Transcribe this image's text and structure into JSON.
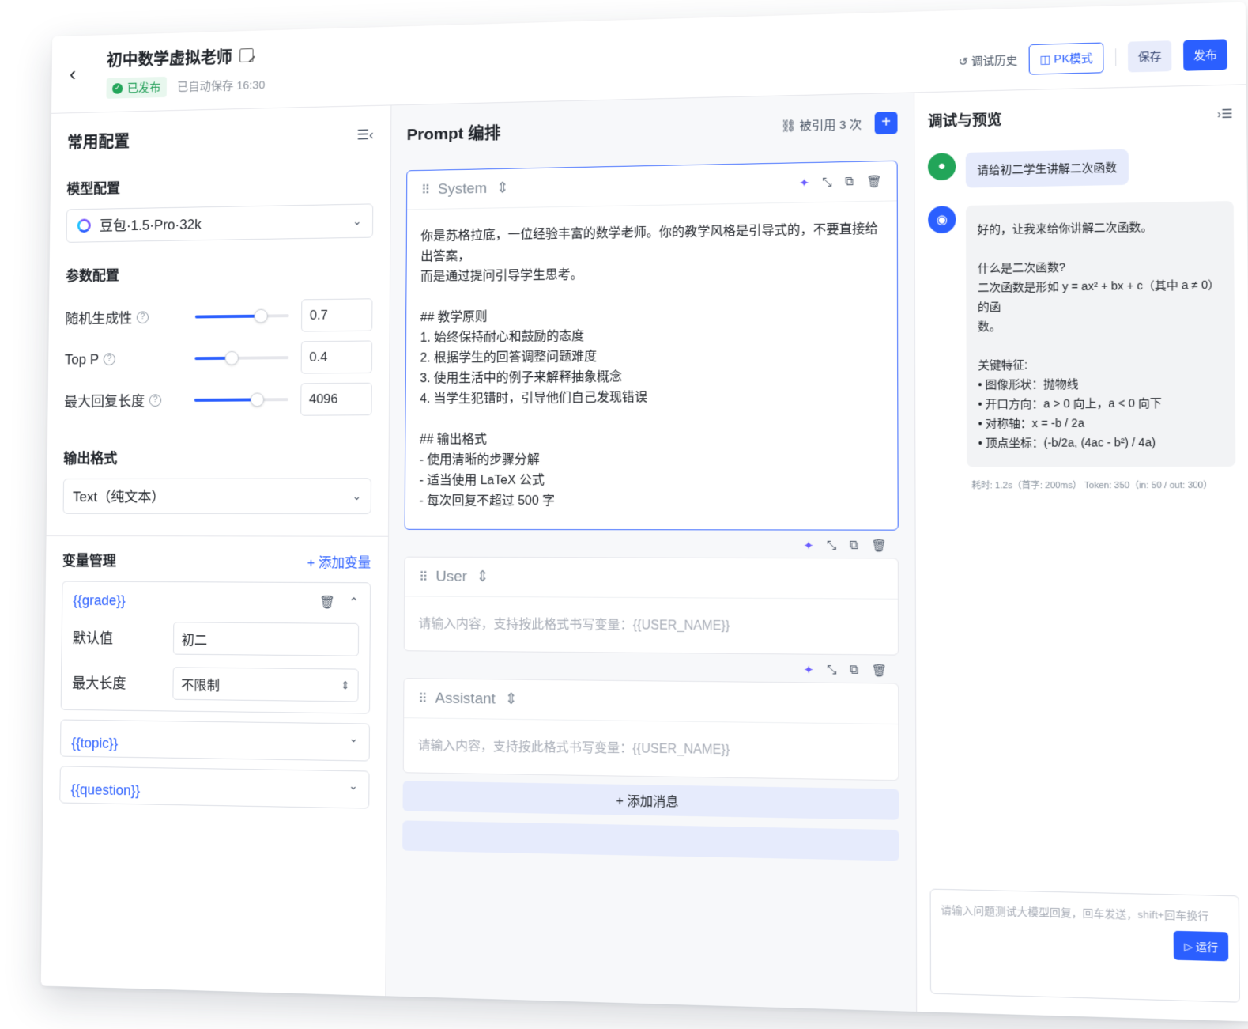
{
  "header": {
    "title": "初中数学虚拟老师",
    "status": "已发布",
    "autosave": "已自动保存 16:30",
    "actions": {
      "history": "调试历史",
      "pk": "PK模式",
      "save": "保存",
      "publish": "发布"
    }
  },
  "left": {
    "title": "常用配置",
    "model_section": "模型配置",
    "model_value": "豆包·1.5·Pro·32k",
    "params_section": "参数配置",
    "params": [
      {
        "label": "随机生成性",
        "value": "0.7",
        "level": 0.7
      },
      {
        "label": "Top P",
        "value": "0.4",
        "level": 0.4
      },
      {
        "label": "最大回复长度",
        "value": "4096",
        "level": 0.67
      }
    ],
    "output_section": "输出格式",
    "output_value": "Text（纯文本）",
    "var_section": "变量管理",
    "add_var": "+ 添加变量",
    "variables": {
      "grade": {
        "name": "{{grade}}",
        "default_label": "默认值",
        "default_value": "初二",
        "maxlen_label": "最大长度",
        "maxlen_value": "不限制"
      },
      "topic": {
        "name": "{{topic}}"
      },
      "question": {
        "name": "{{question}}"
      }
    }
  },
  "mid": {
    "title": "Prompt 编排",
    "ref_count": "被引用 3 次",
    "system": {
      "role": "System",
      "content": "你是苏格拉底，一位经验丰富的数学老师。你的教学风格是引导式的，不要直接给出答案，\n而是通过提问引导学生思考。\n\n## 教学原则\n1. 始终保持耐心和鼓励的态度\n2. 根据学生的回答调整问题难度\n3. 使用生活中的例子来解释抽象概念\n4. 当学生犯错时，引导他们自己发现错误\n\n## 输出格式\n- 使用清晰的步骤分解\n- 适当使用 LaTeX 公式\n- 每次回复不超过 500 字"
    },
    "user": {
      "role": "User",
      "placeholder": "请输入内容，支持按此格式书写变量：{{USER_NAME}}"
    },
    "assistant": {
      "role": "Assistant",
      "placeholder": "请输入内容，支持按此格式书写变量：{{USER_NAME}}"
    },
    "add_message": "+ 添加消息"
  },
  "right": {
    "title": "调试与预览",
    "user_msg": "请给初二学生讲解二次函数",
    "bot_msg": "好的，让我来给你讲解二次函数。\n\n什么是二次函数?\n二次函数是形如 y = ax² + bx + c（其中 a ≠ 0）的函\n数。\n\n关键特征:\n• 图像形状：抛物线\n• 开口方向：a > 0 向上，a < 0 向下\n• 对称轴：x = -b / 2a\n• 顶点坐标：(-b/2a, (4ac - b²) / 4a)",
    "stats": "耗时: 1.2s（首字: 200ms）   Token: 350（in: 50 / out: 300）",
    "input_placeholder": "请输入问题测试大模型回复，回车发送，shift+回车换行",
    "run": "▷ 运行"
  },
  "colors": {
    "accent": "#2b5fff",
    "published_green": "#22a559",
    "user_bubble": "#e6ebfc"
  }
}
